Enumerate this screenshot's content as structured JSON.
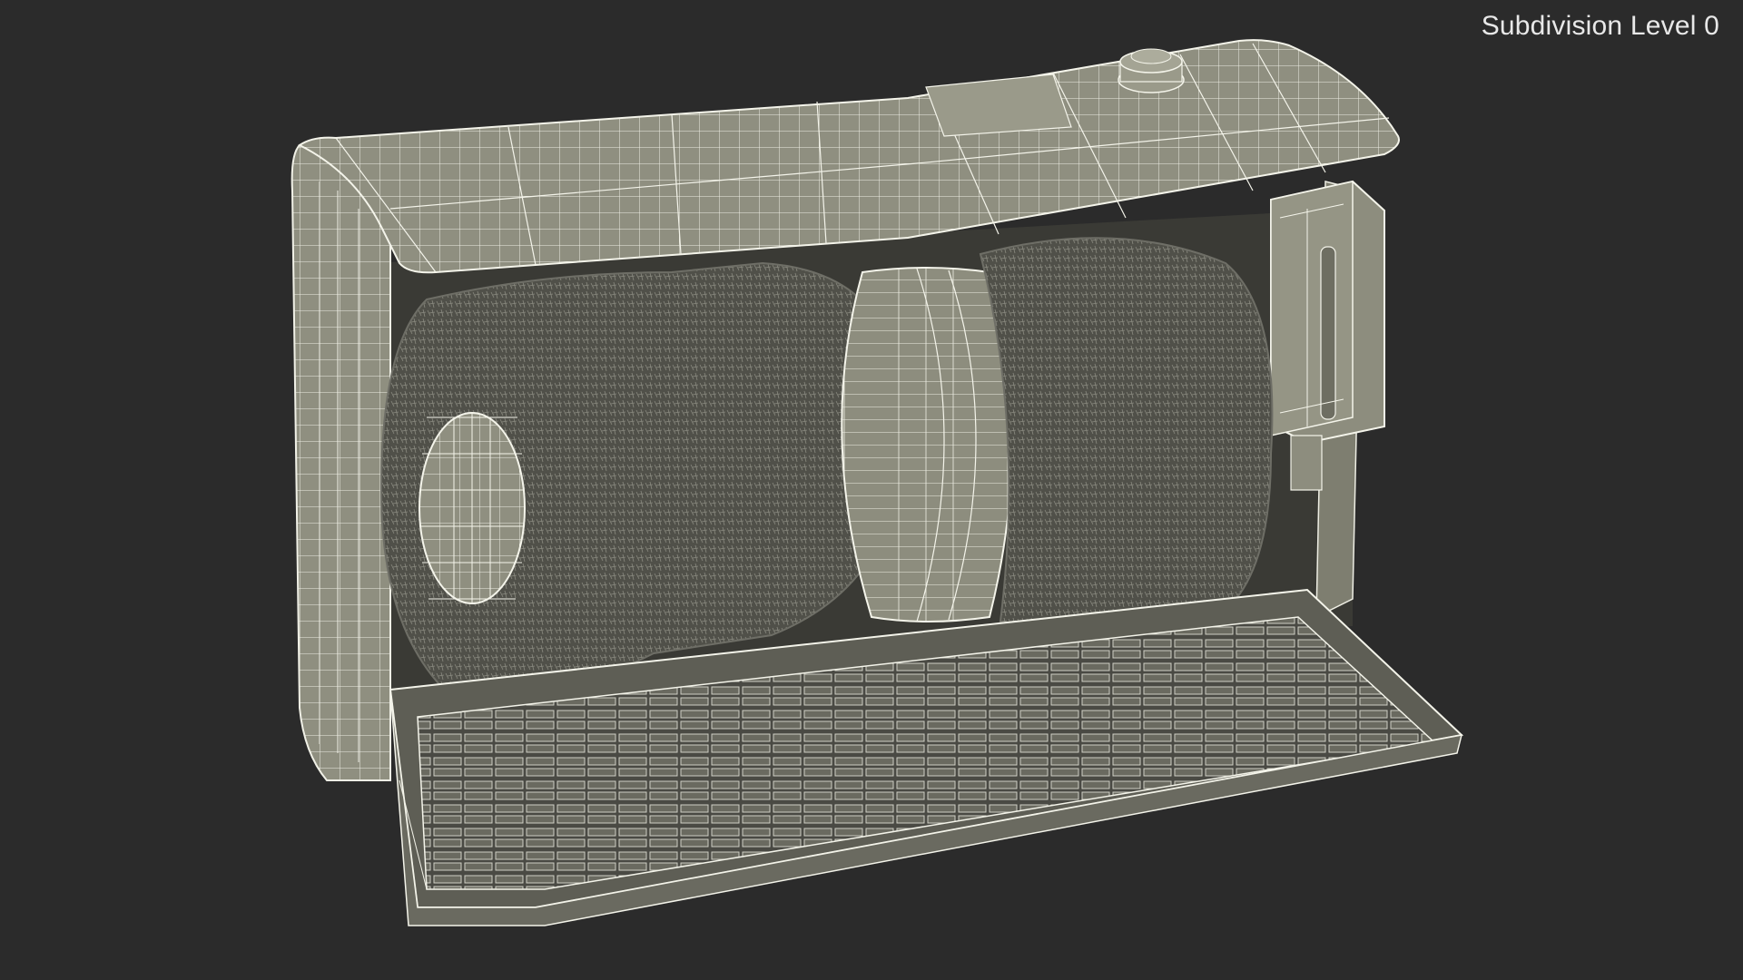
{
  "viewport": {
    "label": "Subdivision Level 0",
    "background": "#2b2b2b"
  },
  "model": {
    "render_style": "wireframe-on-shaded",
    "surface_color": "#8f8f80",
    "wire_color": "#f2f2ea",
    "bristle_color": "#5a5a55"
  }
}
